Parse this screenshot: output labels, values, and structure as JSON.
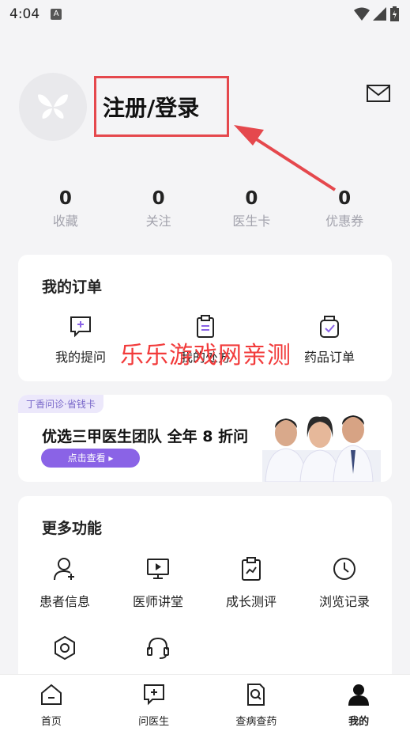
{
  "status_bar": {
    "time": "4:04"
  },
  "header": {
    "login_label": "注册/登录"
  },
  "stats": [
    {
      "value": "0",
      "label": "收藏"
    },
    {
      "value": "0",
      "label": "关注"
    },
    {
      "value": "0",
      "label": "医生卡"
    },
    {
      "value": "0",
      "label": "优惠券"
    }
  ],
  "orders": {
    "title": "我的订单",
    "items": [
      {
        "label": "我的提问",
        "icon": "chat-plus-icon"
      },
      {
        "label": "我的处方",
        "icon": "clipboard-icon"
      },
      {
        "label": "药品订单",
        "icon": "medicine-jar-icon"
      }
    ]
  },
  "watermark": "乐乐游戏网亲测",
  "banner": {
    "tag": "丁香问诊·省钱卡",
    "title": "优选三甲医生团队 全年 8 折问",
    "button": "点击查看 ▸"
  },
  "more": {
    "title": "更多功能",
    "items": [
      {
        "label": "患者信息",
        "icon": "patient-icon"
      },
      {
        "label": "医师讲堂",
        "icon": "video-icon"
      },
      {
        "label": "成长测评",
        "icon": "chart-clipboard-icon"
      },
      {
        "label": "浏览记录",
        "icon": "clock-icon"
      },
      {
        "label": "设置",
        "icon": "settings-icon"
      },
      {
        "label": "在线客服",
        "icon": "headset-icon"
      }
    ]
  },
  "tabbar": [
    {
      "label": "首页",
      "icon": "home-icon"
    },
    {
      "label": "问医生",
      "icon": "chat-plus-icon"
    },
    {
      "label": "查病查药",
      "icon": "search-doc-icon"
    },
    {
      "label": "我的",
      "icon": "user-icon",
      "active": true
    }
  ],
  "colors": {
    "accent": "#8a63e6",
    "highlight": "#e5484d"
  }
}
